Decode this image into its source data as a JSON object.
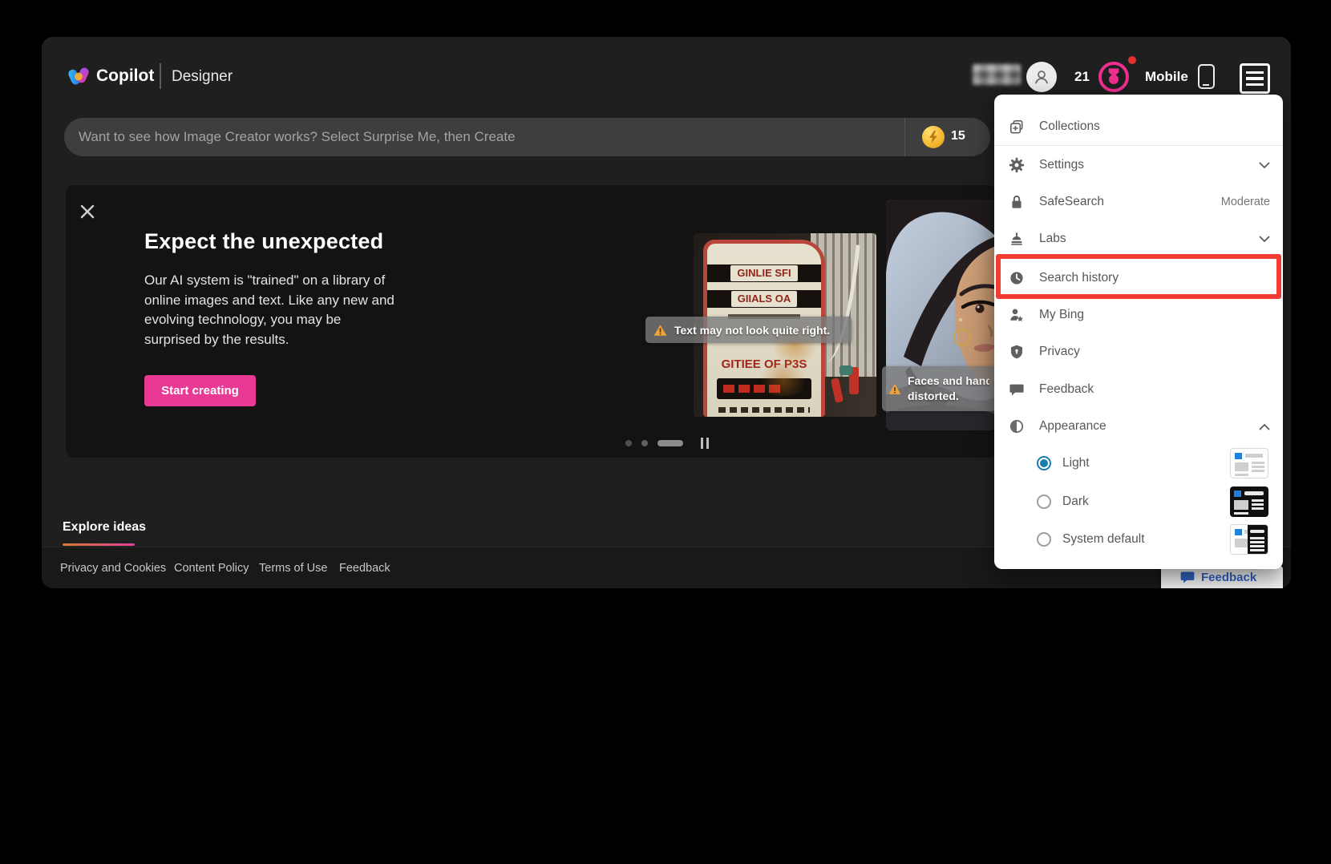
{
  "header": {
    "app_name": "Copilot",
    "product_name": "Designer",
    "rewards_count": "21",
    "device_label": "Mobile"
  },
  "search_bar": {
    "placeholder": "Want to see how Image Creator works? Select Surprise Me, then Create",
    "boost_count": "15"
  },
  "banner": {
    "title": "Expect the unexpected",
    "body_lines": [
      "Our AI system is \"trained\" on a library of",
      "online images and text. Like any new and",
      "evolving technology, you may be",
      "surprised by the results."
    ],
    "cta_label": "Start creating"
  },
  "hero_images": {
    "gas_pump": {
      "sign_line1": "GINLIE SFI",
      "sign_line2": "GIIALS OA",
      "sign_line3": "GITIEE OF P3S"
    },
    "warnings": {
      "text_warning": "Text may not look quite right.",
      "faces_warning_line1": "Faces and hand",
      "faces_warning_line2": "distorted."
    }
  },
  "explore": {
    "title": "Explore ideas"
  },
  "footer": {
    "links": [
      "Privacy and Cookies",
      "Content Policy",
      "Terms of Use",
      "Feedback"
    ]
  },
  "menu": {
    "items": [
      {
        "label": "Collections"
      },
      {
        "label": "Settings",
        "chevron": "down"
      },
      {
        "label": "SafeSearch",
        "value": "Moderate"
      },
      {
        "label": "Labs",
        "chevron": "down"
      },
      {
        "label": "Search history",
        "highlighted": true
      },
      {
        "label": "My Bing"
      },
      {
        "label": "Privacy"
      },
      {
        "label": "Feedback"
      },
      {
        "label": "Appearance",
        "chevron": "up"
      }
    ],
    "appearance_options": [
      {
        "label": "Light",
        "selected": true
      },
      {
        "label": "Dark",
        "selected": false
      },
      {
        "label": "System default",
        "selected": false
      }
    ]
  },
  "feedback_button": {
    "label": "Feedback"
  },
  "colors": {
    "accent_pink": "#e83a95",
    "highlight_red": "#f23b33",
    "radio_selected_blue": "#1a7dad",
    "feedback_blue": "#3263c4",
    "coin_gold": "#f3b72c",
    "underline_gradient_start": "#d97b2e",
    "underline_gradient_end": "#e03f9e"
  }
}
